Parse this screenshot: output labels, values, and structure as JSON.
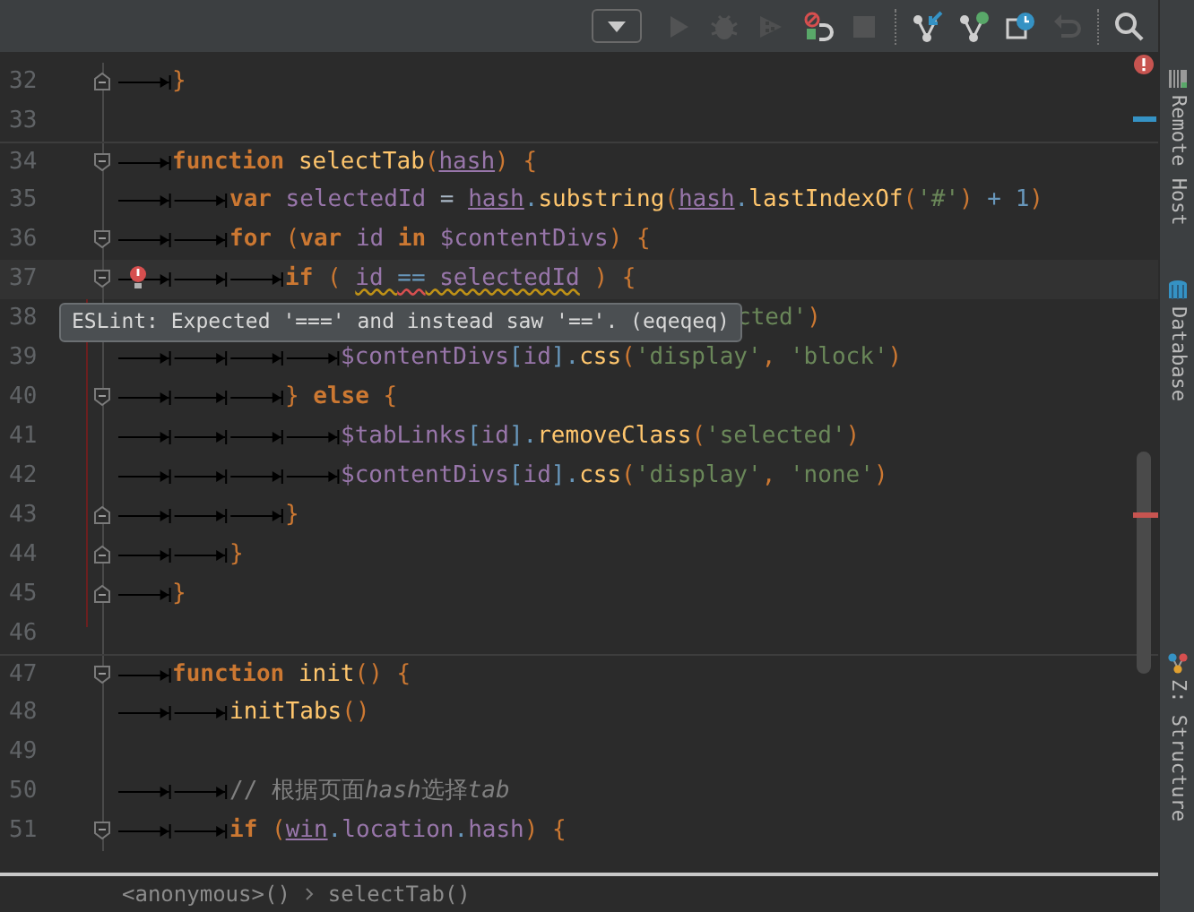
{
  "toolbar": {
    "buttons": [
      {
        "kind": "dropdown",
        "disabled": false
      },
      {
        "kind": "run",
        "disabled": true
      },
      {
        "kind": "debug",
        "disabled": true
      },
      {
        "kind": "coverage",
        "disabled": true
      },
      {
        "kind": "detach",
        "disabled": false
      },
      {
        "kind": "stop",
        "disabled": true
      },
      {
        "kind": "update",
        "disabled": false
      },
      {
        "kind": "commit",
        "disabled": false
      },
      {
        "kind": "history",
        "disabled": false
      },
      {
        "kind": "revert",
        "disabled": true
      },
      {
        "kind": "search",
        "disabled": false
      }
    ]
  },
  "editor": {
    "lines": [
      {
        "number": "32",
        "fold_end": true,
        "tokens": [
          {
            "t": "}",
            "kind": "punct"
          }
        ]
      },
      {
        "number": "33"
      },
      {
        "number": "34",
        "fold_start": true,
        "separator_above": true,
        "tokens": [
          {
            "t": "function",
            "kind": "kw"
          },
          {
            "t": " selectTab",
            "kind": "fn"
          },
          {
            "t": "(",
            "kind": "punct"
          },
          {
            "t": "hash",
            "kind": "param"
          },
          {
            "t": ")",
            "kind": "punct"
          },
          {
            "t": " {",
            "kind": "punct"
          }
        ],
        "children": [
          {
            "number": "35",
            "tokens": [
              {
                "t": "var",
                "kind": "kw"
              },
              {
                "t": " selectedId",
                "kind": "local"
              },
              {
                "t": " = ",
                "kind": "plain"
              },
              {
                "t": "hash",
                "kind": "param"
              },
              {
                "t": ".",
                "kind": "op"
              },
              {
                "t": "substring",
                "kind": "fn"
              },
              {
                "t": "(",
                "kind": "punct"
              },
              {
                "t": "hash",
                "kind": "param"
              },
              {
                "t": ".",
                "kind": "op"
              },
              {
                "t": "lastIndexOf",
                "kind": "fn"
              },
              {
                "t": "(",
                "kind": "punct"
              },
              {
                "t": "'#'",
                "kind": "str"
              },
              {
                "t": ")",
                "kind": "punct"
              },
              {
                "t": " + 1",
                "kind": "num"
              },
              {
                "t": ")",
                "kind": "punct"
              }
            ]
          },
          {
            "number": "36",
            "fold_start": true,
            "tokens": [
              {
                "t": "for",
                "kind": "kw"
              },
              {
                "t": " (",
                "kind": "punct"
              },
              {
                "t": "var",
                "kind": "kw"
              },
              {
                "t": " id",
                "kind": "local"
              },
              {
                "t": " in",
                "kind": "kw"
              },
              {
                "t": " $contentDivs",
                "kind": "local"
              },
              {
                "t": ")",
                "kind": "punct"
              },
              {
                "t": " {",
                "kind": "punct"
              }
            ],
            "children": [
              {
                "number": "37",
                "fold_start": true,
                "current": true,
                "bulb": true,
                "tokens": [
                  {
                    "t": "if",
                    "kind": "kw"
                  },
                  {
                    "t": " ( ",
                    "kind": "punct"
                  },
                  {
                    "t": "id ",
                    "kind": "local",
                    "warning": true
                  },
                  {
                    "t": "==",
                    "kind": "op",
                    "error": true
                  },
                  {
                    "t": " selectedId",
                    "kind": "local",
                    "warning": true
                  },
                  {
                    "t": " ) {",
                    "kind": "punct"
                  }
                ],
                "children": [
                  {
                    "number": "38",
                    "partly_hidden": true,
                    "tokens": [
                      {
                        "t": "cted'",
                        "kind": "str"
                      },
                      {
                        "t": ")",
                        "kind": "punct"
                      }
                    ]
                  },
                  {
                    "number": "39",
                    "tokens": [
                      {
                        "t": "$contentDivs",
                        "kind": "local"
                      },
                      {
                        "t": "[",
                        "kind": "op"
                      },
                      {
                        "t": "id",
                        "kind": "local"
                      },
                      {
                        "t": "]",
                        "kind": "op"
                      },
                      {
                        "t": ".",
                        "kind": "op"
                      },
                      {
                        "t": "css",
                        "kind": "fn"
                      },
                      {
                        "t": "(",
                        "kind": "punct"
                      },
                      {
                        "t": "'display'",
                        "kind": "str"
                      },
                      {
                        "t": ", ",
                        "kind": "punct"
                      },
                      {
                        "t": "'block'",
                        "kind": "str"
                      },
                      {
                        "t": ")",
                        "kind": "punct"
                      }
                    ]
                  }
                ]
              },
              {
                "number": "40",
                "fold_start": true,
                "tokens": [
                  {
                    "t": "}",
                    "kind": "punct"
                  },
                  {
                    "t": " else",
                    "kind": "kw"
                  },
                  {
                    "t": " {",
                    "kind": "punct"
                  }
                ],
                "children": [
                  {
                    "number": "41",
                    "tokens": [
                      {
                        "t": "$tabLinks",
                        "kind": "local"
                      },
                      {
                        "t": "[",
                        "kind": "op"
                      },
                      {
                        "t": "id",
                        "kind": "local"
                      },
                      {
                        "t": "]",
                        "kind": "op"
                      },
                      {
                        "t": ".",
                        "kind": "op"
                      },
                      {
                        "t": "removeClass",
                        "kind": "fn"
                      },
                      {
                        "t": "(",
                        "kind": "punct"
                      },
                      {
                        "t": "'selected'",
                        "kind": "str"
                      },
                      {
                        "t": ")",
                        "kind": "punct"
                      }
                    ]
                  },
                  {
                    "number": "42",
                    "tokens": [
                      {
                        "t": "$contentDivs",
                        "kind": "local"
                      },
                      {
                        "t": "[",
                        "kind": "op"
                      },
                      {
                        "t": "id",
                        "kind": "local"
                      },
                      {
                        "t": "]",
                        "kind": "op"
                      },
                      {
                        "t": ".",
                        "kind": "op"
                      },
                      {
                        "t": "css",
                        "kind": "fn"
                      },
                      {
                        "t": "(",
                        "kind": "punct"
                      },
                      {
                        "t": "'display'",
                        "kind": "str"
                      },
                      {
                        "t": ", ",
                        "kind": "punct"
                      },
                      {
                        "t": "'none'",
                        "kind": "str"
                      },
                      {
                        "t": ")",
                        "kind": "punct"
                      }
                    ]
                  }
                ]
              },
              {
                "number": "43",
                "fold_end": true,
                "tokens": [
                  {
                    "t": "}",
                    "kind": "punct"
                  }
                ]
              }
            ]
          },
          {
            "number": "44",
            "fold_end": true,
            "tokens": [
              {
                "t": "}",
                "kind": "punct"
              }
            ]
          }
        ]
      },
      {
        "number": "45",
        "fold_end": true,
        "tokens": [
          {
            "t": "}",
            "kind": "punct"
          }
        ]
      },
      {
        "number": "46"
      },
      {
        "number": "47",
        "fold_start": true,
        "separator_above": true,
        "tokens": [
          {
            "t": "function",
            "kind": "kw"
          },
          {
            "t": " init",
            "kind": "fn"
          },
          {
            "t": "()",
            "kind": "punct"
          },
          {
            "t": " {",
            "kind": "punct"
          }
        ],
        "children": [
          {
            "number": "48",
            "tokens": [
              {
                "t": "initTabs",
                "kind": "fn"
              },
              {
                "t": "()",
                "kind": "punct"
              }
            ]
          },
          {
            "number": "49"
          },
          {
            "number": "50",
            "tokens": [
              {
                "t": "// 根据页面",
                "kind": "comment"
              },
              {
                "t": "hash",
                "kind": "comment_it"
              },
              {
                "t": "选择",
                "kind": "comment"
              },
              {
                "t": "tab",
                "kind": "comment_it"
              }
            ]
          },
          {
            "number": "51",
            "fold_start": true,
            "tokens": [
              {
                "t": "if",
                "kind": "kw"
              },
              {
                "t": " (",
                "kind": "punct"
              },
              {
                "t": "win",
                "kind": "param"
              },
              {
                "t": ".",
                "kind": "op"
              },
              {
                "t": "location",
                "kind": "local"
              },
              {
                "t": ".",
                "kind": "op"
              },
              {
                "t": "hash",
                "kind": "local"
              },
              {
                "t": ")",
                "kind": "punct"
              },
              {
                "t": " {",
                "kind": "punct"
              }
            ]
          }
        ]
      }
    ]
  },
  "tooltip": {
    "text": "ESLint: Expected '===' and instead saw '=='. (eqeqeq)"
  },
  "breadcrumbs": [
    "<anonymous>()",
    "selectTab()"
  ],
  "side_tabs": [
    {
      "kind": "remote",
      "label": "Remote Host"
    },
    {
      "kind": "database",
      "label": "Database"
    },
    {
      "kind": "structure",
      "label": "Z: Structure"
    }
  ]
}
